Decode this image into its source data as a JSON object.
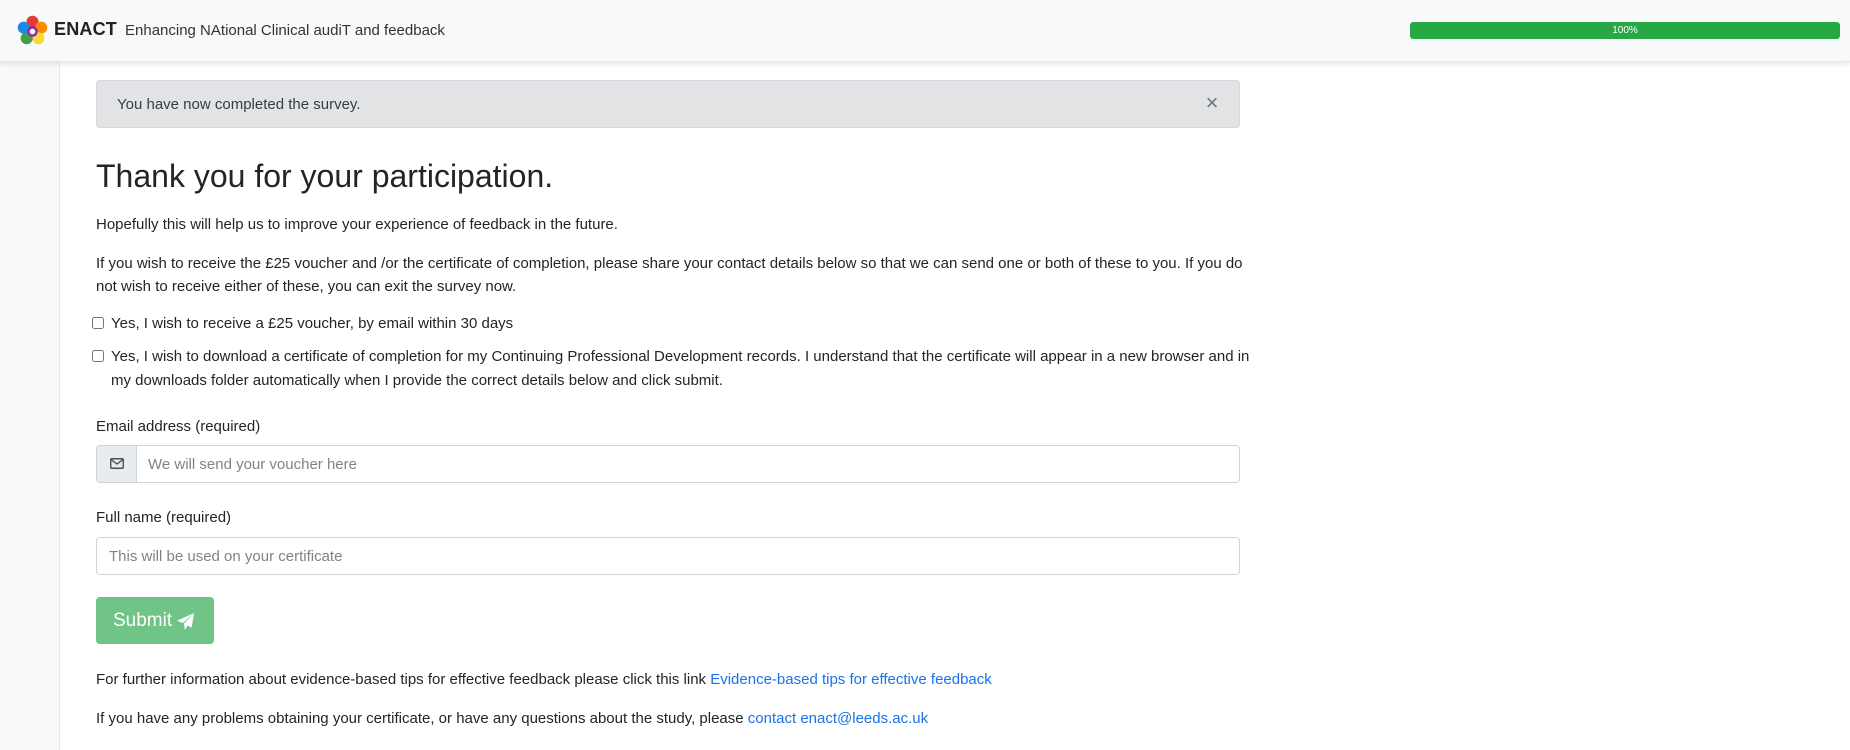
{
  "header": {
    "brand_name": "ENACT",
    "brand_subtitle": "Enhancing NAtional Clinical audiT and feedback",
    "logo_icon": "enact-logo",
    "progress": {
      "value_percent": 100,
      "label": "100%",
      "color": "#28a745"
    }
  },
  "alert": {
    "message": "You have now completed the survey.",
    "close_label": "×"
  },
  "main": {
    "title": "Thank you for your participation.",
    "intro": "Hopefully this will help us to improve your experience of feedback in the future.",
    "instructions": "If you wish to receive the £25 voucher and /or the certificate of completion, please share your contact details below so that we can send one or both of these to you. If you do not wish to receive either of these, you can exit the survey now.",
    "options": [
      {
        "label": "Yes, I wish to receive a £25 voucher, by email within 30 days",
        "checked": false
      },
      {
        "label": "Yes, I wish to download a certificate of completion for my Continuing Professional Development records. I understand that the certificate will appear in a new browser and in my downloads folder automatically when I provide the correct details below and click submit.",
        "checked": false
      }
    ]
  },
  "form": {
    "email": {
      "label": "Email address (required)",
      "placeholder": "We will send your voucher here",
      "value": "",
      "icon": "envelope-icon"
    },
    "name": {
      "label": "Full name (required)",
      "placeholder": "This will be used on your certificate",
      "value": ""
    },
    "submit_label": "Submit",
    "submit_icon": "paper-plane-icon",
    "submit_color": "#70c488"
  },
  "footer": {
    "tips_text": "For further information about evidence-based tips for effective feedback please click this link ",
    "tips_link": "Evidence-based tips for effective feedback",
    "contact_text": "If you have any problems obtaining your certificate, or have any questions about the study, please ",
    "contact_link": "contact enact@leeds.ac.uk",
    "link_color": "#1a73e8"
  }
}
